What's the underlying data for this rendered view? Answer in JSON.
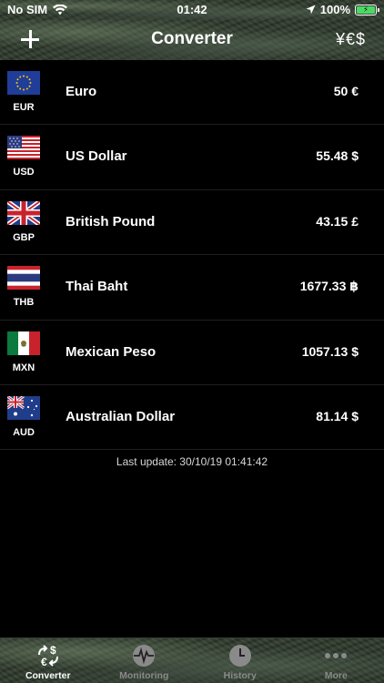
{
  "status_bar": {
    "carrier": "No SIM",
    "time": "01:42",
    "battery": "100%"
  },
  "nav": {
    "title": "Converter",
    "currency_symbols": "¥€$"
  },
  "currencies": [
    {
      "code": "EUR",
      "name": "Euro",
      "amount": "50 €",
      "flag": "eu-flag-icon"
    },
    {
      "code": "USD",
      "name": "US Dollar",
      "amount": "55.48 $",
      "flag": "us-flag-icon"
    },
    {
      "code": "GBP",
      "name": "British Pound",
      "amount": "43.15 £",
      "flag": "uk-flag-icon"
    },
    {
      "code": "THB",
      "name": "Thai Baht",
      "amount": "1677.33 ฿",
      "flag": "thai-flag-icon"
    },
    {
      "code": "MXN",
      "name": "Mexican Peso",
      "amount": "1057.13 $",
      "flag": "mexico-flag-icon"
    },
    {
      "code": "AUD",
      "name": "Australian Dollar",
      "amount": "81.14 $",
      "flag": "australia-flag-icon"
    }
  ],
  "last_update": "Last update: 30/10/19 01:41:42",
  "tabs": [
    {
      "label": "Converter",
      "icon": "converter-icon",
      "active": true
    },
    {
      "label": "Monitoring",
      "icon": "pulse-icon",
      "active": false
    },
    {
      "label": "History",
      "icon": "clock-icon",
      "active": false
    },
    {
      "label": "More",
      "icon": "more-dots-icon",
      "active": false
    }
  ],
  "colors": {
    "battery_fill": "#4cd964",
    "background": "#000000",
    "inactive_tab": "#8a8a8a"
  }
}
